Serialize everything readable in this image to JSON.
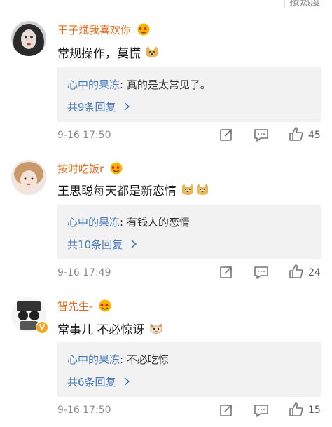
{
  "header": {
    "partial_text": "| 按热度"
  },
  "comments": [
    {
      "username": "王子斌我喜欢你",
      "badge_icon": "heart-eyes-face-icon",
      "text": "常规操作，莫慌",
      "emojis": [
        "doge-icon"
      ],
      "reply": {
        "user": "心中的果冻",
        "separator": ": ",
        "text": "真的是太常见了。"
      },
      "more_replies": "共9条回复",
      "time": "9-16 17:50",
      "likes": "45",
      "verified": false
    },
    {
      "username": "按时吃饭r",
      "badge_icon": "heart-eyes-face-icon",
      "text": "王思聪每天都是新恋情",
      "emojis": [
        "doge-icon",
        "doge-icon"
      ],
      "reply": {
        "user": "心中的果冻",
        "separator": ": ",
        "text": "有钱人的恋情"
      },
      "more_replies": "共10条回复",
      "time": "9-16 17:49",
      "likes": "24",
      "verified": false
    },
    {
      "username": "智先生-",
      "badge_icon": "heart-eyes-face-icon",
      "text": "常事儿 不必惊讶",
      "emojis": [
        "cat-face-icon"
      ],
      "reply": {
        "user": "心中的果冻",
        "separator": ": ",
        "text": "不必吃惊"
      },
      "more_replies": "共6条回复",
      "time": "9-16 17:50",
      "likes": "15",
      "verified": true,
      "verified_mark": "V"
    }
  ],
  "colors": {
    "username": "#e86a1a",
    "reply_user": "#4a7ab5",
    "reply_bg": "#f2f2f2",
    "meta": "#8c8c8c",
    "badge": "#f6a623"
  }
}
